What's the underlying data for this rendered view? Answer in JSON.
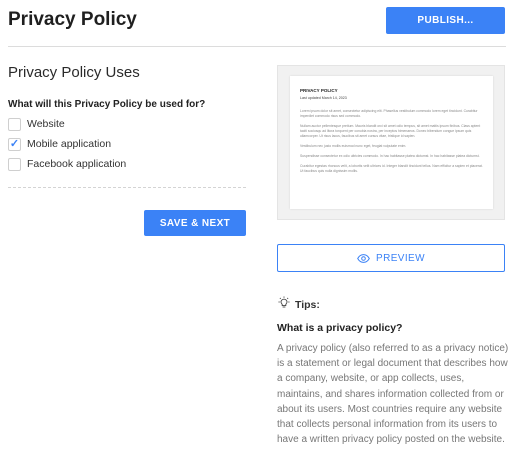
{
  "header": {
    "title": "Privacy Policy",
    "publish_label": "PUBLISH..."
  },
  "form": {
    "section_title": "Privacy Policy Uses",
    "question": "What will this Privacy Policy be used for?",
    "options": [
      {
        "label": "Website",
        "checked": false
      },
      {
        "label": "Mobile application",
        "checked": true
      },
      {
        "label": "Facebook application",
        "checked": false
      }
    ],
    "save_label": "SAVE & NEXT"
  },
  "preview": {
    "doc_title": "PRIVACY POLICY",
    "doc_date": "Last updated March 14, 2023",
    "paragraphs": [
      "Lorem ipsum dolor sit amet, consectetur adipiscing elit. Phasellus vestibulum commodo lorem eget tincidunt. Curabitur imperdiet commodo risus sed commodo.",
      "Nullam auctor pellentesque pretium. Mauris blandit orci sit amet odio tempus, sit amet mattis ipsum finibus. Class aptent taciti sociosqu ad litora torquent per conubia nostra, per inceptos himenaeos. Donec bibendum congue ipsum quis ullamcorper. Ut risus lacus, faucibus sit amet cursus vitae, tristique id sapien.",
      "Vestibulum nec justo mollis euismod nunc eget, feugiat vulputate enim.",
      "Suspendisse consectetur ex odio ultricies commodo. In hac habitasse platea dictumst. In hac habitasse platea dictumst.",
      "Curabitur egestas rhoncus velit, a lobortis velit ultrices id. Integer blandit tincidunt tellus. Nam efficitur a sapien et placerat. Ut faucibus quis nulla dignissim mollis."
    ],
    "preview_label": "PREVIEW"
  },
  "tips": {
    "heading": "Tips:",
    "question": "What is a privacy policy?",
    "body": "A privacy policy (also referred to as a privacy notice) is a statement or legal document that describes how a company, website, or app collects, uses, maintains, and shares information collected from or about its users. Most countries require any website that collects personal information from its users to have a written privacy policy posted on the website."
  },
  "colors": {
    "accent": "#3b82f6",
    "muted_text": "#777777"
  }
}
